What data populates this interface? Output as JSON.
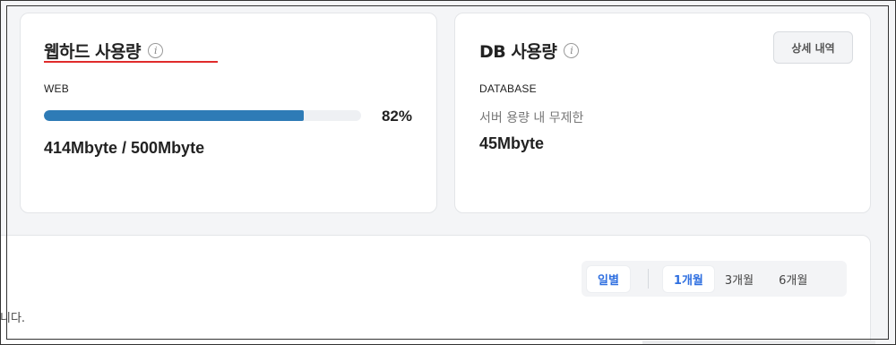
{
  "web_card": {
    "title": "웹하드 사용량",
    "info_icon": "info-icon",
    "label": "WEB",
    "progress_percent": 82,
    "progress_text": "82%",
    "usage": "414Mbyte / 500Mbyte",
    "underline_color": "#e02b2b",
    "bar_color": "#2e7bb6"
  },
  "db_card": {
    "title": "DB 사용량",
    "info_icon": "info-icon",
    "label": "DATABASE",
    "note": "서버 용량 내 무제한",
    "usage": "45Mbyte",
    "detail_button": "상세 내역"
  },
  "range_selector": {
    "daily": "일별",
    "options": [
      "1개월",
      "3개월",
      "6개월"
    ],
    "active": "1개월",
    "accent_color": "#2f6fe0"
  },
  "bottom": {
    "desc_fragment": "니다."
  }
}
